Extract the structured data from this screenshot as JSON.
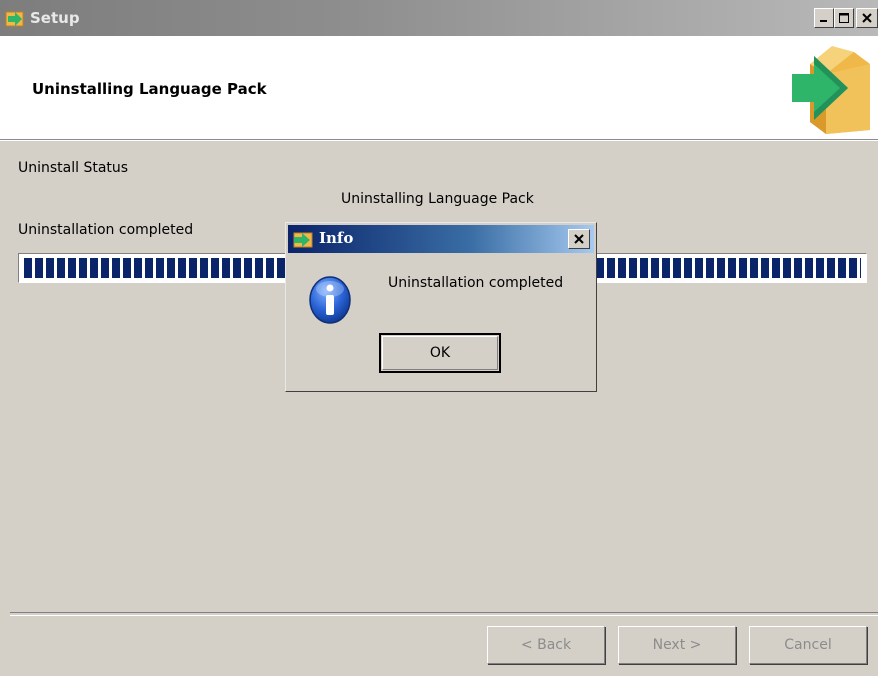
{
  "window": {
    "title": "Setup",
    "controls": {
      "minimize_icon": "minimize-icon",
      "maximize_icon": "maximize-icon",
      "close_icon": "close-icon"
    }
  },
  "header": {
    "heading": "Uninstalling Language Pack",
    "logo_icon": "setup-box-arrow-icon"
  },
  "status": {
    "group_label": "Uninstall Status",
    "caption": "Uninstalling Language Pack",
    "detail": "Uninstallation completed",
    "progress": 1.0
  },
  "buttons": {
    "back": "< Back",
    "next": "Next >",
    "cancel": "Cancel"
  },
  "dialog": {
    "title": "Info",
    "message": "Uninstallation completed",
    "ok": "OK",
    "icon": "info-icon"
  },
  "colors": {
    "progress_fill": "#0a246a",
    "dialog_title_start": "#0a246a",
    "dialog_title_end": "#a6caf0",
    "logo_green": "#2fb56a",
    "logo_box": "#f0b848"
  }
}
